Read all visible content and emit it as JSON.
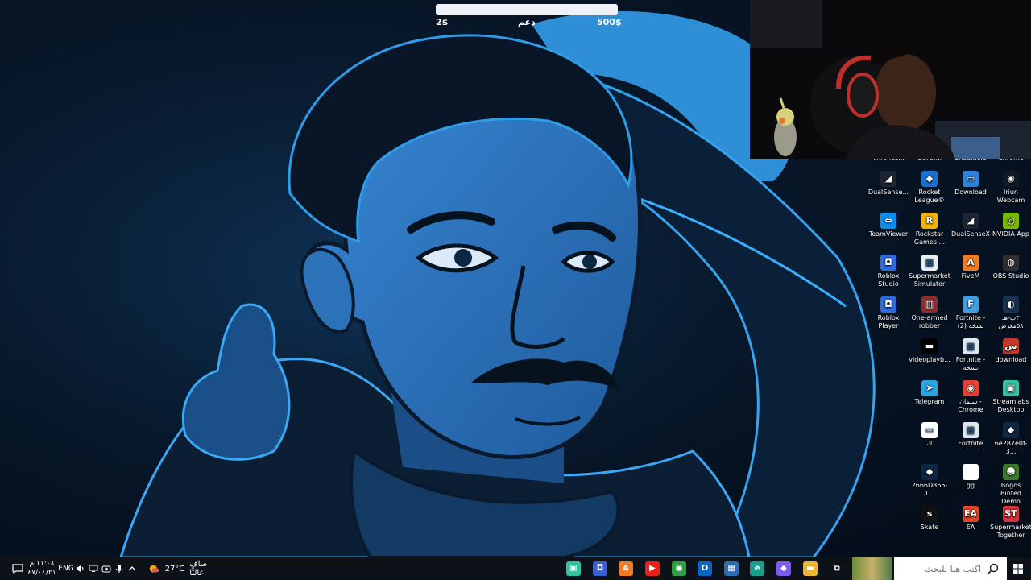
{
  "donation": {
    "min": "2$",
    "title": "دعم",
    "max": "500$",
    "progress": 0
  },
  "desktop_icons": {
    "cut_top": [
      "Thrones...",
      "GeFor...",
      "Shoulders",
      "Chrome"
    ],
    "icons": [
      {
        "label": "DualSense...",
        "icon": "dualsense-icon",
        "color": "#1e2530",
        "glyph": "◢"
      },
      {
        "label": "Rocket League®",
        "icon": "rocket-league-icon",
        "color": "#1b6fd1",
        "glyph": "◆"
      },
      {
        "label": "Download",
        "icon": "download-icon",
        "color": "#2c82d8",
        "glyph": "▭"
      },
      {
        "label": "Iriun Webcam",
        "icon": "webcam-icon",
        "color": "#101a26",
        "glyph": "◉"
      },
      {
        "label": "TeamViewer",
        "icon": "teamviewer-icon",
        "color": "#0e8ee9",
        "glyph": "⇔"
      },
      {
        "label": "Rockstar Games ...",
        "icon": "rockstar-icon",
        "color": "#f2b10c",
        "glyph": "R"
      },
      {
        "label": "DualSenseX",
        "icon": "dualsensex-icon",
        "color": "#1e2530",
        "glyph": "◢"
      },
      {
        "label": "NVIDIA App",
        "icon": "nvidia-icon",
        "color": "#76b900",
        "glyph": "◎"
      },
      {
        "label": "Roblox Studio",
        "icon": "roblox-studio-icon",
        "color": "#2f6be0",
        "glyph": "◘"
      },
      {
        "label": "Supermarket Simulator",
        "icon": "supermarket-simulator-icon",
        "color": "#e6eef0",
        "glyph": "▦"
      },
      {
        "label": "FiveM",
        "icon": "fivem-icon",
        "color": "#f27b25",
        "glyph": "A"
      },
      {
        "label": "OBS Studio",
        "icon": "obs-icon",
        "color": "#302e31",
        "glyph": "◍"
      },
      {
        "label": "Roblox Player",
        "icon": "roblox-player-icon",
        "color": "#2f6be0",
        "glyph": "◘"
      },
      {
        "label": "One-armed robber",
        "icon": "slot-machine-icon",
        "color": "#8a2d2d",
        "glyph": "▥"
      },
      {
        "label": "Fortnite - نسخة (2)",
        "icon": "fortnite-icon",
        "color": "#3f9de0",
        "glyph": "F"
      },
      {
        "label": "٣ب-هـ ٥٨معرض",
        "icon": "steam-icon",
        "color": "#16324d",
        "glyph": "◐"
      },
      {
        "label": "videoplayb...",
        "icon": "video-file-icon",
        "color": "#000000",
        "glyph": "▬"
      },
      {
        "label": "Fortnite - نسخة",
        "icon": "fortnite-icon",
        "color": "#dfe9ee",
        "glyph": "▦"
      },
      {
        "label": "download",
        "icon": "download-file-icon",
        "color": "#c0392b",
        "glyph": "س"
      },
      {
        "label": "Telegram",
        "icon": "telegram-icon",
        "color": "#2aa3df",
        "glyph": "➤"
      },
      {
        "label": "سلمان - Chrome",
        "icon": "chrome-profile-icon",
        "color": "#e34133",
        "glyph": "◉"
      },
      {
        "label": "Streamlabs Desktop",
        "icon": "streamlabs-icon",
        "color": "#31c3a2",
        "glyph": "▣"
      },
      {
        "label": "ك",
        "icon": "shortcut-icon",
        "color": "#ffffff",
        "glyph": "▭"
      },
      {
        "label": "Fortnite",
        "icon": "fortnite-icon",
        "color": "#dfe9ee",
        "glyph": "▦"
      },
      {
        "label": "6e287e0f-3...",
        "icon": "steam-file-icon",
        "color": "#0f2740",
        "glyph": "◆"
      },
      {
        "label": "2666D865-1...",
        "icon": "steam-file-icon",
        "color": "#0f2740",
        "glyph": "◆"
      },
      {
        "label": "gg",
        "icon": "text-file-icon",
        "color": "#ffffff",
        "glyph": ""
      },
      {
        "label": "Bogos Binted Demo",
        "icon": "bogos-icon",
        "color": "#3a7a2a",
        "glyph": "☻"
      },
      {
        "label": "Skate",
        "icon": "skate-icon",
        "color": "#111111",
        "glyph": "s"
      },
      {
        "label": "EA",
        "icon": "ea-icon",
        "color": "#e6452a",
        "glyph": "EA"
      },
      {
        "label": "Supermarket Together",
        "icon": "supermarket-together-icon",
        "color": "#d8333c",
        "glyph": "ST"
      }
    ]
  },
  "taskbar": {
    "time": "١١:٠٨ م",
    "date": "٤٧/٠٤/٢١",
    "lang": "ENG",
    "weather_temp": "27°C",
    "weather_text": "صافٍ غالبًا",
    "search_placeholder": "اكتب هنا للبحث",
    "apps": [
      {
        "name": "streamlabs",
        "icon": "streamlabs-icon",
        "color": "#31c3a2",
        "glyph": "▣"
      },
      {
        "name": "roblox",
        "icon": "roblox-icon",
        "color": "#3a5fd0",
        "glyph": "◘"
      },
      {
        "name": "fivem",
        "icon": "fivem-icon",
        "color": "#f27b25",
        "glyph": "A"
      },
      {
        "name": "youtube",
        "icon": "youtube-icon",
        "color": "#e62117",
        "glyph": "▶"
      },
      {
        "name": "chrome",
        "icon": "chrome-icon",
        "color": "#2f9e44",
        "glyph": "◉"
      },
      {
        "name": "outlook",
        "icon": "outlook-icon",
        "color": "#0a64c2",
        "glyph": "O"
      },
      {
        "name": "store",
        "icon": "store-icon",
        "color": "#2b6cb0",
        "glyph": "▦"
      },
      {
        "name": "edge",
        "icon": "edge-icon",
        "color": "#1a9e8a",
        "glyph": "e"
      },
      {
        "name": "copilot",
        "icon": "copilot-icon",
        "color": "#7b5cf0",
        "glyph": "◆"
      },
      {
        "name": "file-explorer",
        "icon": "folder-icon",
        "color": "#e8b632",
        "glyph": "▬"
      },
      {
        "name": "task-view",
        "icon": "task-view-icon",
        "color": "#0d1118",
        "glyph": "⧉"
      }
    ]
  }
}
